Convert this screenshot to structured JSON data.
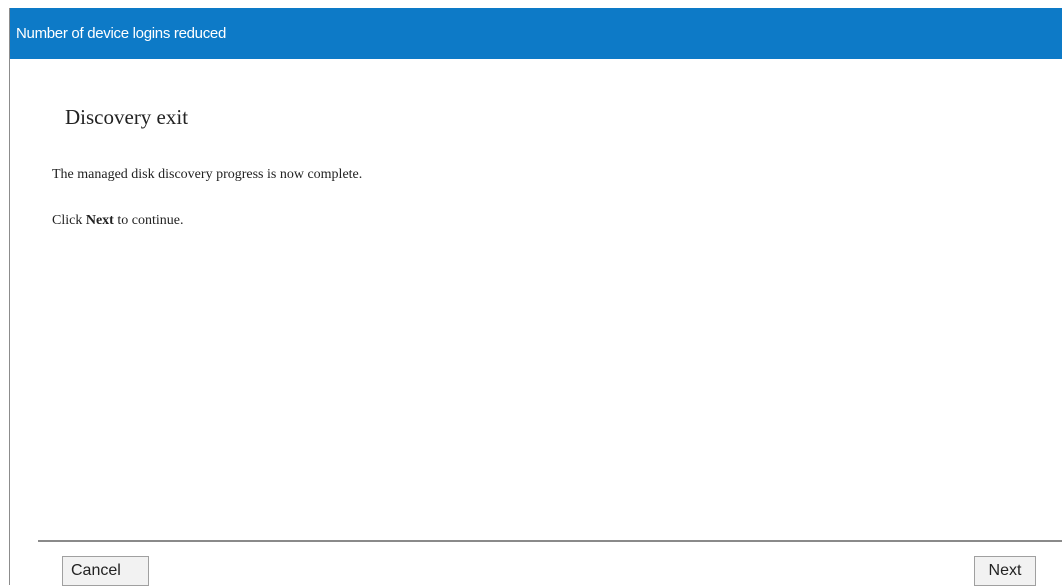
{
  "window": {
    "title": "Number of device logins reduced"
  },
  "main": {
    "heading": "Discovery exit",
    "message": "The managed disk discovery progress is now complete.",
    "instruction_prefix": "Click",
    "instruction_bold": "Next",
    "instruction_suffix": "to continue."
  },
  "footer": {
    "cancel_label": "Cancel",
    "next_label": "Next"
  },
  "colors": {
    "titlebar_background": "#0d7ac7",
    "titlebar_text": "#ffffff"
  }
}
